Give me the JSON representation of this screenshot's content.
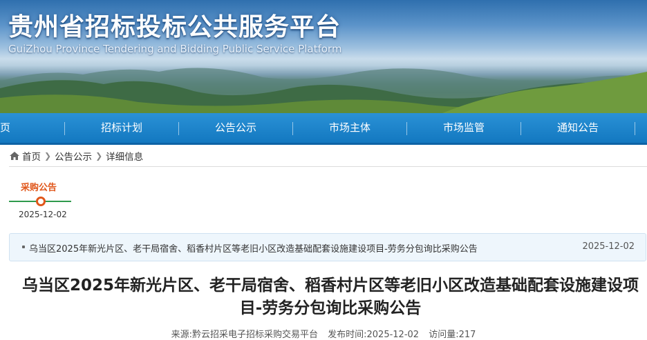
{
  "site": {
    "title": "贵州省招标投标公共服务平台",
    "subtitle": "GuiZhou Province Tendering and Bidding Public Service Platform"
  },
  "nav": {
    "items": [
      {
        "label": "首页"
      },
      {
        "label": "招标计划"
      },
      {
        "label": "公告公示"
      },
      {
        "label": "市场主体"
      },
      {
        "label": "市场监管"
      },
      {
        "label": "通知公告"
      }
    ]
  },
  "breadcrumb": {
    "icon": "home-icon",
    "items": [
      "首页",
      "公告公示",
      "详细信息"
    ]
  },
  "timeline": {
    "label": "采购公告",
    "date": "2025-12-02",
    "colors": {
      "label": "#e0561a",
      "line": "#2e9a4c"
    }
  },
  "notice": {
    "title": "乌当区2025年新光片区、老干局宿舍、稻香村片区等老旧小区改造基础配套设施建设项目-劳务分包询比采购公告",
    "date": "2025-12-02"
  },
  "article": {
    "title": "乌当区2025年新光片区、老干局宿舍、稻香村片区等老旧小区改造基础配套设施建设项目-劳务分包询比采购公告",
    "source": "来源:黔云招采电子招标采购交易平台",
    "publish_time": "发布时间:2025-12-02",
    "views": "访问量:217"
  },
  "colors": {
    "nav": "#1378c0",
    "accent": "#e0561a"
  }
}
